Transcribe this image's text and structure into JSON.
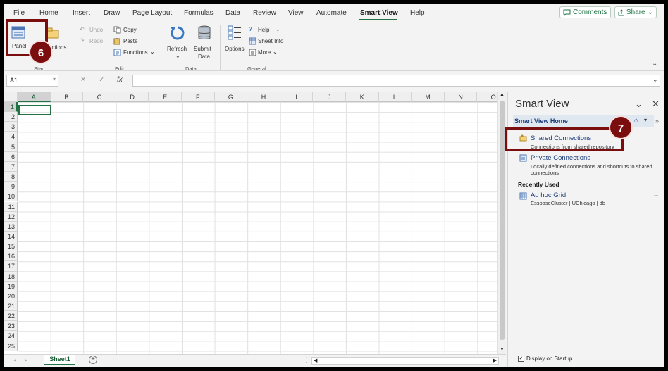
{
  "menu": {
    "tabs": [
      {
        "label": "File"
      },
      {
        "label": "Home"
      },
      {
        "label": "Insert"
      },
      {
        "label": "Draw"
      },
      {
        "label": "Page Layout"
      },
      {
        "label": "Formulas"
      },
      {
        "label": "Data"
      },
      {
        "label": "Review"
      },
      {
        "label": "View"
      },
      {
        "label": "Automate"
      },
      {
        "label": "Smart View"
      },
      {
        "label": "Help"
      }
    ],
    "comments_label": "Comments",
    "share_label": "Share"
  },
  "ribbon": {
    "panel_label": "Panel",
    "connections_label": "ections",
    "start_group": "Start",
    "undo_label": "Undo",
    "redo_label": "Redo",
    "copy_label": "Copy",
    "paste_label": "Paste",
    "functions_label": "Functions",
    "edit_group": "Edit",
    "refresh_label": "Refresh",
    "submit_label": "Submit",
    "submit_label2": "Data",
    "data_group": "Data",
    "options_label": "Options",
    "help_label": "Help",
    "sheetinfo_label": "Sheet Info",
    "more_label": "More",
    "general_group": "General"
  },
  "formula_bar": {
    "name_box": "A1",
    "fx": "fx"
  },
  "grid": {
    "columns": [
      "A",
      "B",
      "C",
      "D",
      "E",
      "F",
      "G",
      "H",
      "I",
      "J",
      "K",
      "L",
      "M",
      "N",
      "O"
    ],
    "rows": [
      "1",
      "2",
      "3",
      "4",
      "5",
      "6",
      "7",
      "8",
      "9",
      "10",
      "11",
      "12",
      "13",
      "14",
      "15",
      "16",
      "17",
      "18",
      "19",
      "20",
      "21",
      "22",
      "23",
      "24",
      "25"
    ],
    "active_cell": "A1"
  },
  "sheets": {
    "tabs": [
      "Sheet1"
    ]
  },
  "pane": {
    "title": "Smart View",
    "home_label": "Smart View Home",
    "shared_title": "Shared Connections",
    "shared_desc": "Connections from shared repository",
    "private_title": "Private Connections",
    "private_desc1": "Locally defined connections and shortcuts to shared",
    "private_desc2": "connections",
    "recently_used": "Recently Used",
    "recent_item_title": "Ad hoc Grid",
    "recent_item_desc": "EssbaseCluster | UChicago | db",
    "display_startup": "Display on Startup",
    "display_startup_checked": true
  },
  "callouts": {
    "panel_step": "6",
    "shared_step": "7"
  },
  "colors": {
    "accent": "#217346",
    "callout": "#7a0e0e",
    "link": "#1f3f7c"
  }
}
